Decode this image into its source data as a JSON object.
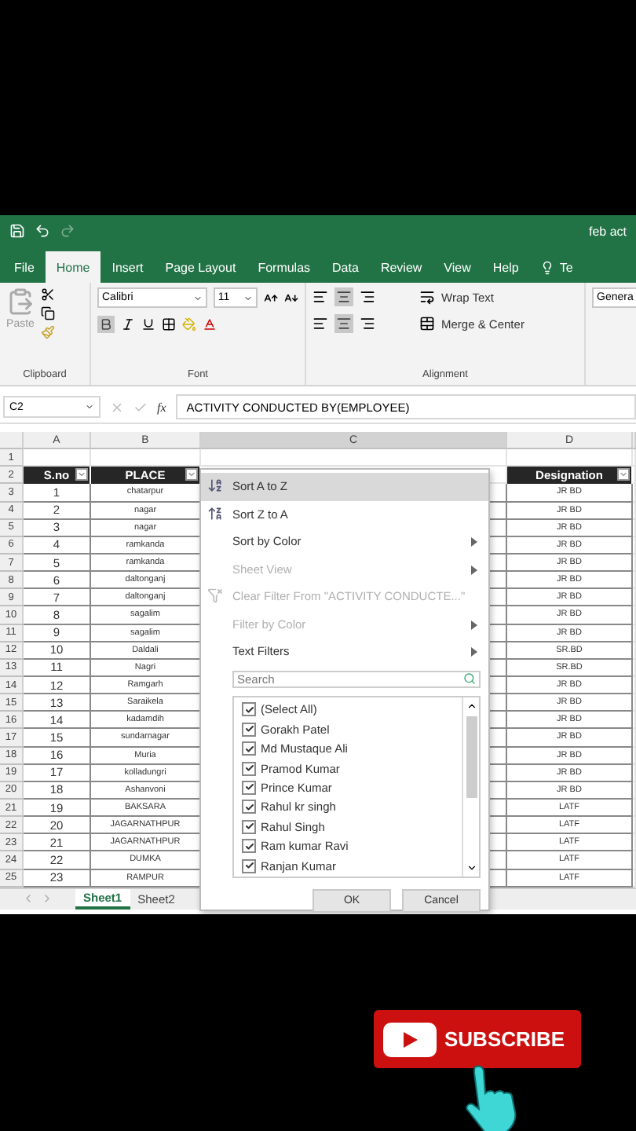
{
  "title_bar": {
    "title": "feb act"
  },
  "ribbon_tabs": [
    {
      "label": "File",
      "selected": false
    },
    {
      "label": "Home",
      "selected": true
    },
    {
      "label": "Insert",
      "selected": false
    },
    {
      "label": "Page Layout",
      "selected": false
    },
    {
      "label": "Formulas",
      "selected": false
    },
    {
      "label": "Data",
      "selected": false
    },
    {
      "label": "Review",
      "selected": false
    },
    {
      "label": "View",
      "selected": false
    },
    {
      "label": "Help",
      "selected": false
    },
    {
      "label": "Te",
      "selected": false
    }
  ],
  "ribbon": {
    "paste_label": "Paste",
    "font_name": "Calibri",
    "font_size": "11",
    "wrap_text": "Wrap Text",
    "merge_center": "Merge & Center",
    "number_format": "Genera",
    "groups": [
      "Clipboard",
      "Font",
      "Alignment"
    ]
  },
  "formula_bar": {
    "name_box": "C2",
    "function_label": "fx",
    "formula": "ACTIVITY CONDUCTED BY(EMPLOYEE)"
  },
  "columns": [
    "A",
    "B",
    "C",
    "D"
  ],
  "row_numbers": [
    "1",
    "2",
    "3",
    "4",
    "5",
    "6",
    "7",
    "8",
    "9",
    "10",
    "11",
    "12",
    "13",
    "14",
    "15",
    "16",
    "17",
    "18",
    "19",
    "20",
    "21",
    "22",
    "23",
    "24",
    "25"
  ],
  "table_headers": {
    "a": "S.no",
    "b": "PLACE",
    "d": "Designation"
  },
  "rows": [
    {
      "sno": "1",
      "place": "chatarpur",
      "designation": "JR BD"
    },
    {
      "sno": "2",
      "place": "nagar",
      "designation": "JR BD"
    },
    {
      "sno": "3",
      "place": "nagar",
      "designation": "JR BD"
    },
    {
      "sno": "4",
      "place": "ramkanda",
      "designation": "JR BD"
    },
    {
      "sno": "5",
      "place": "ramkanda",
      "designation": "JR BD"
    },
    {
      "sno": "6",
      "place": "daltonganj",
      "designation": "JR BD"
    },
    {
      "sno": "7",
      "place": "daltonganj",
      "designation": "JR BD"
    },
    {
      "sno": "8",
      "place": "sagalim",
      "designation": "JR BD"
    },
    {
      "sno": "9",
      "place": "sagalim",
      "designation": "JR BD"
    },
    {
      "sno": "10",
      "place": "Daldali",
      "designation": "SR.BD"
    },
    {
      "sno": "11",
      "place": "Nagri",
      "designation": "SR.BD"
    },
    {
      "sno": "12",
      "place": "Ramgarh",
      "designation": "JR BD"
    },
    {
      "sno": "13",
      "place": "Saraikela",
      "designation": "JR BD"
    },
    {
      "sno": "14",
      "place": "kadamdih",
      "designation": "JR BD"
    },
    {
      "sno": "15",
      "place": "sundarnagar",
      "designation": "JR BD"
    },
    {
      "sno": "16",
      "place": "Muria",
      "designation": "JR BD"
    },
    {
      "sno": "17",
      "place": "kolladungri",
      "designation": "JR BD"
    },
    {
      "sno": "18",
      "place": "Ashanvoni",
      "designation": "JR BD"
    },
    {
      "sno": "19",
      "place": "BAKSARA",
      "designation": "LATF"
    },
    {
      "sno": "20",
      "place": "JAGARNATHPUR",
      "designation": "LATF"
    },
    {
      "sno": "21",
      "place": "JAGARNATHPUR",
      "designation": "LATF"
    },
    {
      "sno": "22",
      "place": "DUMKA",
      "designation": "LATF"
    },
    {
      "sno": "23",
      "place": "RAMPUR",
      "designation": "LATF"
    }
  ],
  "filter_menu": {
    "items": [
      {
        "kind": "sort_az",
        "label": "Sort A to Z",
        "highlighted": true,
        "disabled": false,
        "submenu": false
      },
      {
        "kind": "sort_za",
        "label": "Sort Z to A",
        "highlighted": false,
        "disabled": false,
        "submenu": false
      },
      {
        "kind": "plain",
        "label": "Sort by Color",
        "highlighted": false,
        "disabled": false,
        "submenu": true
      },
      {
        "kind": "plain",
        "label": "Sheet View",
        "highlighted": false,
        "disabled": true,
        "submenu": true
      },
      {
        "kind": "clear",
        "label": "Clear Filter From \"ACTIVITY CONDUCTE...\"",
        "highlighted": false,
        "disabled": true,
        "submenu": false
      },
      {
        "kind": "plain",
        "label": "Filter by Color",
        "highlighted": false,
        "disabled": true,
        "submenu": true
      },
      {
        "kind": "plain",
        "label": "Text Filters",
        "highlighted": false,
        "disabled": false,
        "submenu": true
      }
    ],
    "search": {
      "placeholder": "Search"
    },
    "values": [
      {
        "label": "(Select All)",
        "checked": true
      },
      {
        "label": "Gorakh Patel",
        "checked": true
      },
      {
        "label": "Md Mustaque Ali",
        "checked": true
      },
      {
        "label": "Pramod Kumar",
        "checked": true
      },
      {
        "label": "Prince Kumar",
        "checked": true
      },
      {
        "label": "Rahul kr singh",
        "checked": true
      },
      {
        "label": "Rahul Singh",
        "checked": true
      },
      {
        "label": "Ram kumar Ravi",
        "checked": true
      },
      {
        "label": "Ranjan Kumar",
        "checked": true
      }
    ],
    "buttons": [
      "OK",
      "Cancel"
    ]
  },
  "sheet_tabs": [
    {
      "label": "Sheet1",
      "selected": true
    },
    {
      "label": "Sheet2",
      "selected": false
    }
  ],
  "overlay": {
    "subscribe": "SUBSCRIBE"
  }
}
